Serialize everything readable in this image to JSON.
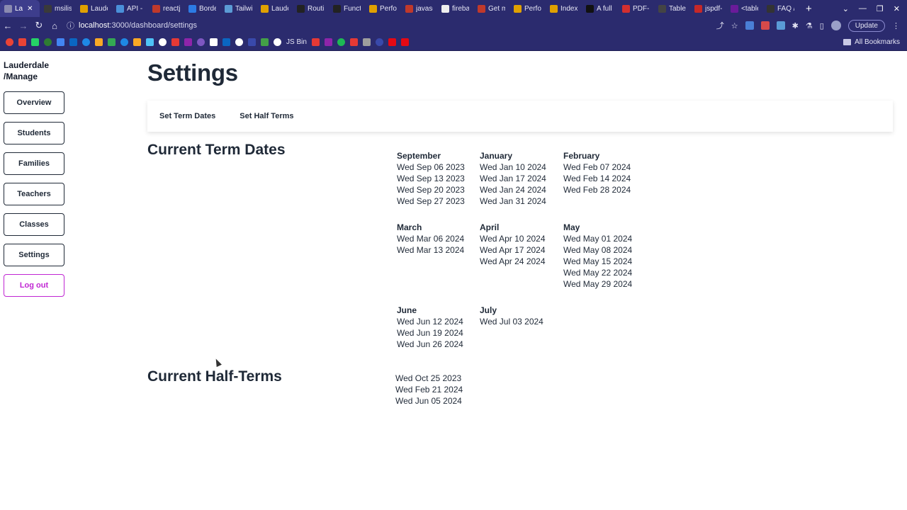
{
  "browser": {
    "tabs": [
      {
        "label": "La",
        "active": true
      },
      {
        "label": "msilis"
      },
      {
        "label": "Laude"
      },
      {
        "label": "API - F"
      },
      {
        "label": "reactj"
      },
      {
        "label": "Borde"
      },
      {
        "label": "Tailwi"
      },
      {
        "label": "Laude"
      },
      {
        "label": "Routi"
      },
      {
        "label": "Functi"
      },
      {
        "label": "Perfo"
      },
      {
        "label": "javasc"
      },
      {
        "label": "fireba"
      },
      {
        "label": "Get m"
      },
      {
        "label": "Perfo"
      },
      {
        "label": "Index"
      },
      {
        "label": "A full"
      },
      {
        "label": "PDF-L"
      },
      {
        "label": "Table"
      },
      {
        "label": "jspdf-"
      },
      {
        "label": "<table"
      },
      {
        "label": "FAQ /"
      }
    ],
    "tab_colors": [
      "#8a8ab0",
      "#3a3a3a",
      "#e0a100",
      "#4a90d9",
      "#c0392b",
      "#2c7be5",
      "#5b9bd5",
      "#e0a100",
      "#222222",
      "#222222",
      "#e0a100",
      "#c0392b",
      "#eeeeee",
      "#c0392b",
      "#e0a100",
      "#e0a100",
      "#111111",
      "#d32f2f",
      "#444444",
      "#c62828",
      "#6a1b9a",
      "#333333"
    ],
    "url_host": "localhost",
    "url_path": ":3000/dashboard/settings",
    "update_label": "Update",
    "bookmark_text": "JS Bin",
    "all_bookmarks_label": "All Bookmarks",
    "bookmark_colors": [
      "#ea4335",
      "#ea4335",
      "#25d366",
      "#2e7d32",
      "#4285f4",
      "#0a66c2",
      "#1e88e5",
      "#f9a825",
      "#34a853",
      "#1e88e5",
      "#f9a825",
      "#4fc3f7",
      "#ffffff",
      "#e53935",
      "#8e24aa",
      "#7e57c2",
      "#ffffff",
      "#0a66c2",
      "#ffffff",
      "#3949ab",
      "#43a047",
      "#ffffff",
      "#e53935",
      "#8e24aa",
      "#1db954",
      "#e53935",
      "#9e9e9e",
      "#3949ab",
      "#e50914",
      "#e50914"
    ]
  },
  "sidebar": {
    "brand_line1": "Lauderdale",
    "brand_line2": "/Manage",
    "items": [
      {
        "label": "Overview"
      },
      {
        "label": "Students"
      },
      {
        "label": "Families"
      },
      {
        "label": "Teachers"
      },
      {
        "label": "Classes"
      },
      {
        "label": "Settings"
      },
      {
        "label": "Log out"
      }
    ]
  },
  "main": {
    "title": "Settings",
    "tabs": [
      {
        "label": "Set Term Dates"
      },
      {
        "label": "Set Half Terms"
      }
    ],
    "term_dates_title": "Current Term Dates",
    "term_months": [
      {
        "name": "September",
        "dates": [
          "Wed Sep 06 2023",
          "Wed Sep 13 2023",
          "Wed Sep 20 2023",
          "Wed Sep 27 2023"
        ]
      },
      {
        "name": "January",
        "dates": [
          "Wed Jan 10 2024",
          "Wed Jan 17 2024",
          "Wed Jan 24 2024",
          "Wed Jan 31 2024"
        ]
      },
      {
        "name": "February",
        "dates": [
          "Wed Feb 07 2024",
          "Wed Feb 14 2024",
          "Wed Feb 28 2024"
        ]
      },
      {
        "name": "March",
        "dates": [
          "Wed Mar 06 2024",
          "Wed Mar 13 2024"
        ]
      },
      {
        "name": "April",
        "dates": [
          "Wed Apr 10 2024",
          "Wed Apr 17 2024",
          "Wed Apr 24 2024"
        ]
      },
      {
        "name": "May",
        "dates": [
          "Wed May 01 2024",
          "Wed May 08 2024",
          "Wed May 15 2024",
          "Wed May 22 2024",
          "Wed May 29 2024"
        ]
      },
      {
        "name": "June",
        "dates": [
          "Wed Jun 12 2024",
          "Wed Jun 19 2024",
          "Wed Jun 26 2024"
        ]
      },
      {
        "name": "July",
        "dates": [
          "Wed Jul 03 2024"
        ]
      }
    ],
    "half_terms_title": "Current Half-Terms",
    "half_terms": [
      "Wed Oct 25 2023",
      "Wed Feb 21 2024",
      "Wed Jun 05 2024"
    ]
  },
  "colors": {
    "chrome_bg": "#2b2b6e",
    "text": "#1f2937",
    "logout_accent": "#c026d3"
  }
}
